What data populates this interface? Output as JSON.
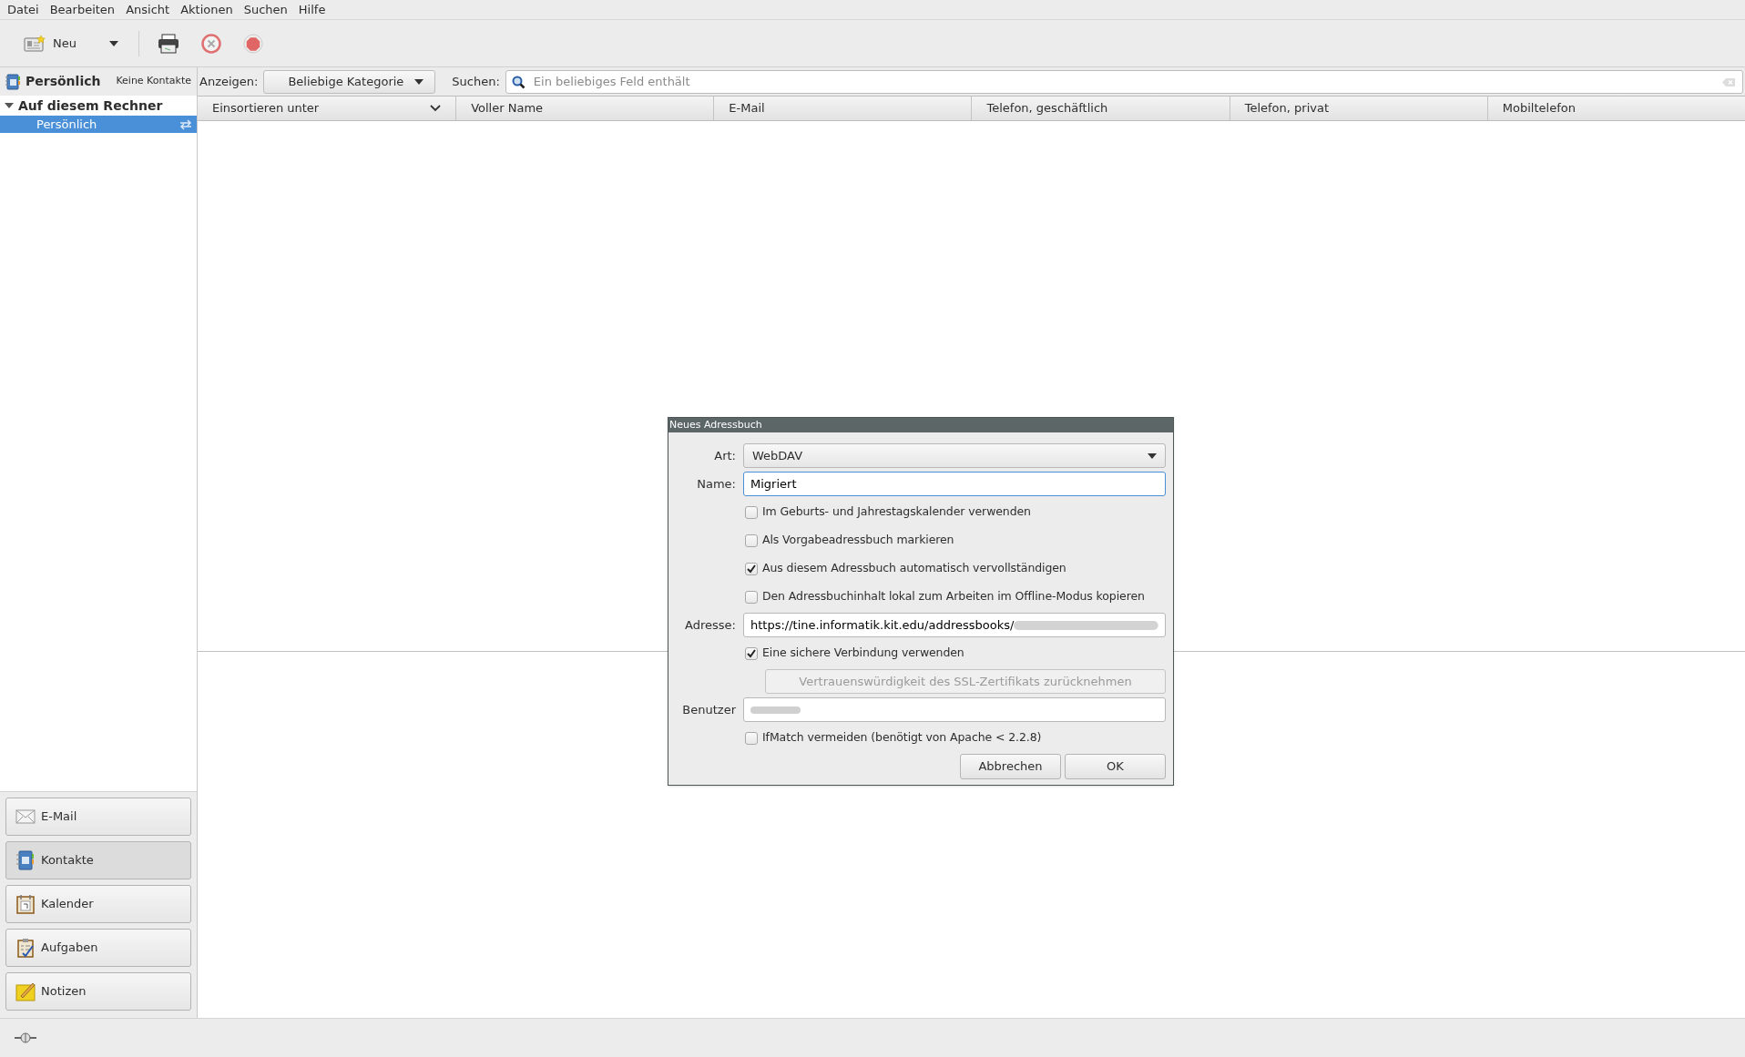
{
  "menu": [
    "Datei",
    "Bearbeiten",
    "Ansicht",
    "Aktionen",
    "Suchen",
    "Hilfe"
  ],
  "toolbar": {
    "new_label": "Neu"
  },
  "sidebar": {
    "title": "Persönlich",
    "count": "Keine Kontakte",
    "tree": [
      {
        "label": "Auf diesem Rechner",
        "expanded": true,
        "children": [
          {
            "label": "Persönlich",
            "selected": true
          }
        ]
      }
    ],
    "nav": [
      {
        "label": "E-Mail",
        "kind": "mail",
        "selected": false
      },
      {
        "label": "Kontakte",
        "kind": "contacts",
        "selected": true
      },
      {
        "label": "Kalender",
        "kind": "calendar",
        "selected": false
      },
      {
        "label": "Aufgaben",
        "kind": "tasks",
        "selected": false
      },
      {
        "label": "Notizen",
        "kind": "notes",
        "selected": false
      }
    ]
  },
  "filter": {
    "label": "Anzeigen:",
    "category": "Beliebige Kategorie",
    "search_label": "Suchen:",
    "search": {
      "placeholder": "Ein beliebiges Feld enthält"
    }
  },
  "table": {
    "columns": [
      {
        "label": "Einsortieren unter",
        "sorted": true
      },
      {
        "label": "Voller Name",
        "sorted": false
      },
      {
        "label": "E-Mail",
        "sorted": false
      },
      {
        "label": "Telefon, geschäftlich",
        "sorted": false
      },
      {
        "label": "Telefon, privat",
        "sorted": false
      },
      {
        "label": "Mobiltelefon",
        "sorted": false
      }
    ]
  },
  "dialog": {
    "title": "Neues Adressbuch",
    "type": {
      "label": "Art:",
      "value": "WebDAV"
    },
    "name": {
      "label": "Name:",
      "value": "Migriert"
    },
    "options": [
      {
        "label": "Im Geburts- und Jahrestagskalender verwenden",
        "checked": false
      },
      {
        "label": "Als Vorgabeadressbuch markieren",
        "checked": false
      },
      {
        "label": "Aus diesem Adressbuch automatisch vervollständigen",
        "checked": true
      },
      {
        "label": "Den Adressbuchinhalt lokal zum Arbeiten im Offline-Modus kopieren",
        "checked": false
      }
    ],
    "address": {
      "label": "Adresse:",
      "value": "https://tine.informatik.kit.edu/addressbooks/"
    },
    "secure": {
      "label": "Eine sichere Verbindung verwenden",
      "checked": true
    },
    "ssl_button": {
      "label": "Vertrauenswürdigkeit des SSL-Zertifikats zurücknehmen",
      "disabled": true
    },
    "user": {
      "label": "Benutzer"
    },
    "ifmatch": {
      "label": "IfMatch vermeiden (benötigt von Apache < 2.2.8)",
      "checked": false
    },
    "buttons": [
      "Abbrechen",
      "OK"
    ]
  }
}
